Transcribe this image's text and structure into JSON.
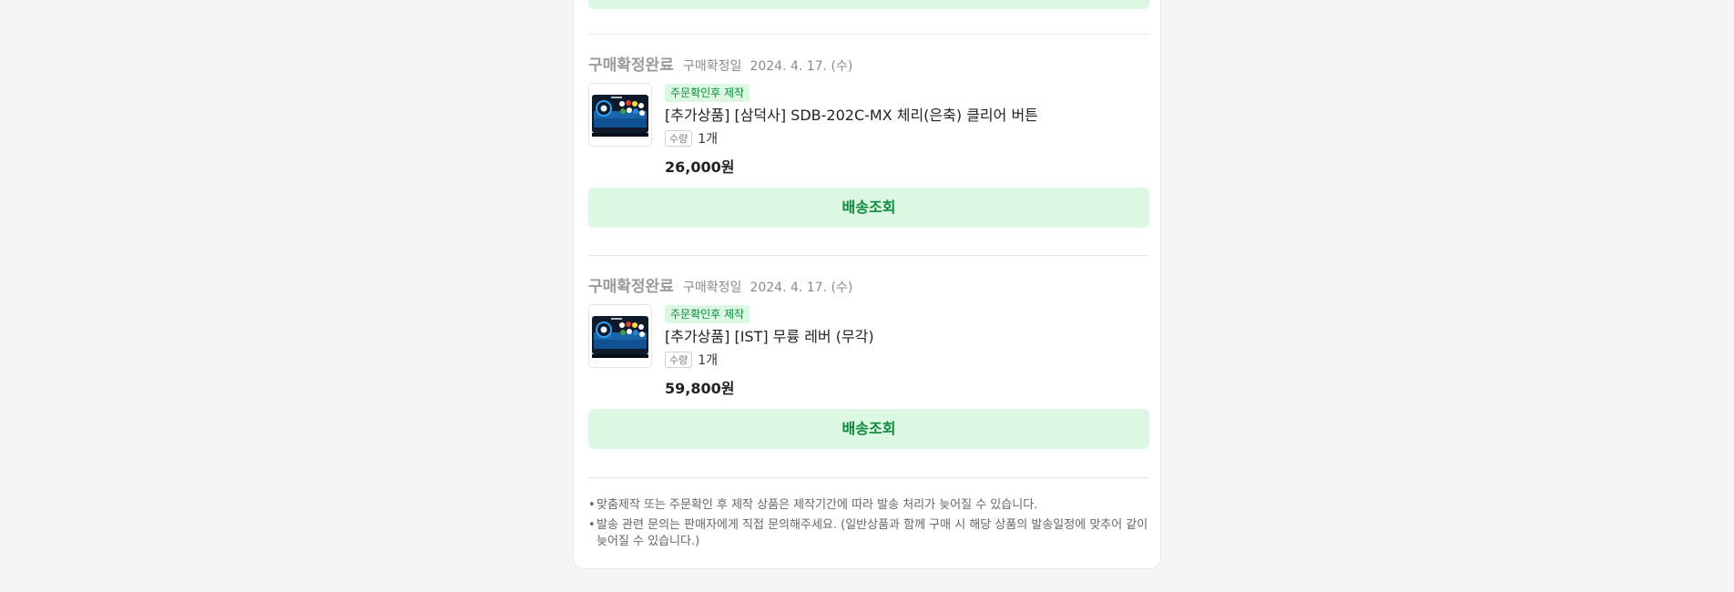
{
  "orders": [
    {
      "status": "구매확정완료",
      "confirm_label": "구매확정일",
      "confirm_date": "2024. 4. 17. (수)",
      "badge": "주문확인후 제작",
      "product_name": "[추가상품] [삼덕사] SDB-202C-MX 체리(은축) 클리어 버튼",
      "qty_label": "수량",
      "qty_value": "1개",
      "price": "26,000원",
      "track_button": "배송조회"
    },
    {
      "status": "구매확정완료",
      "confirm_label": "구매확정일",
      "confirm_date": "2024. 4. 17. (수)",
      "badge": "주문확인후 제작",
      "product_name": "[추가상품] [IST] 무륭 레버 (무각)",
      "qty_label": "수량",
      "qty_value": "1개",
      "price": "59,800원",
      "track_button": "배송조회"
    }
  ],
  "notes": [
    "맞춤제작 또는 주문확인 후 제작 상품은 제작기간에 따라 발송 처리가 늦어질 수 있습니다.",
    "발송 관련 문의는 판매자에게 직접 문의해주세요. (일반상품과 함께 구매 시 해당 상품의 발송일정에 맞추어 같이 늦어질 수 있습니다.)"
  ],
  "notes_bullet": "•",
  "colors": {
    "accent_green": "#0b8a3a",
    "button_bg": "#dcf8e3",
    "page_bg": "#f4f5f7"
  },
  "icons": {
    "product_thumbnail": "arcade-controller-image"
  }
}
